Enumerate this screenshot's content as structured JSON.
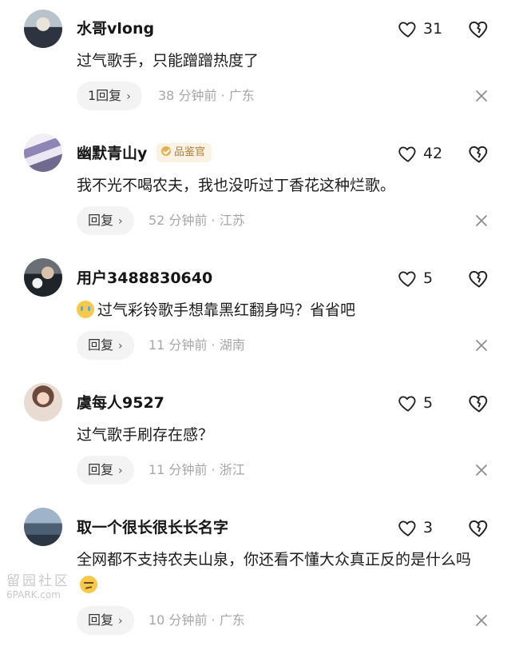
{
  "comments": [
    {
      "username": "水哥vlong",
      "badge": "",
      "like_count": "31",
      "text": "过气歌手，只能蹭蹭热度了",
      "emoji": "",
      "reply_label": "1回复",
      "meta": "38 分钟前 · 广东"
    },
    {
      "username": "幽默青山y",
      "badge": "品鉴官",
      "like_count": "42",
      "text": "我不光不喝农夫，我也没听过丁香花这种烂歌。",
      "emoji": "",
      "reply_label": "回复",
      "meta": "52 分钟前 · 江苏"
    },
    {
      "username": "用户3488830640",
      "badge": "",
      "like_count": "5",
      "text": "过气彩铃歌手想靠黑红翻身吗？省省吧",
      "emoji": "crying-face",
      "reply_label": "回复",
      "meta": "11 分钟前 · 湖南"
    },
    {
      "username": "虞每人9527",
      "badge": "",
      "like_count": "5",
      "text": "过气歌手刷存在感？",
      "emoji": "",
      "reply_label": "回复",
      "meta": "11 分钟前 · 浙江"
    },
    {
      "username": "取一个很长很长长名字",
      "badge": "",
      "like_count": "3",
      "text": "全网都不支持农夫山泉，你还看不懂大众真正反的是什么吗",
      "emoji": "smirking-face",
      "reply_label": "回复",
      "meta": "10 分钟前 · 广东"
    }
  ],
  "watermark": {
    "top": "留园社区",
    "bottom": "6PARK.com"
  },
  "colors": {
    "badge_bg": "#fbf2e3",
    "badge_text": "#b57c2e",
    "meta_text": "#a6a6a6",
    "reply_bg": "#f3f3f3"
  }
}
